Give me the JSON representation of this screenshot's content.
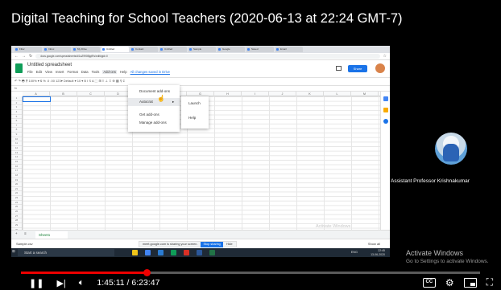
{
  "video": {
    "title": "Digital Teaching for School Teachers (2020-06-13 at 22:24 GMT-7)",
    "current_time": "1:45:11",
    "duration": "6:23:47",
    "progress": 0.274,
    "participant_name": "Assistant Professor Krishnakumar",
    "activate_title": "Activate Windows",
    "activate_sub": "Go to Settings to activate Windows."
  },
  "browser": {
    "url": "docs.google.com/spreadsheets/d/1aZ990BjqtRs/edit#gid=0",
    "tabs": [
      "Filter",
      "Inbox",
      "My Drive",
      "Untitled",
      "Contact",
      "Untitled",
      "Sample",
      "Google",
      "Saved",
      "Email"
    ]
  },
  "sheets": {
    "doc_title": "Untitled spreadsheet",
    "menus": [
      "File",
      "Edit",
      "View",
      "Insert",
      "Format",
      "Data",
      "Tools",
      "Add-ons",
      "Help"
    ],
    "saved_text": "All changes saved in Drive",
    "share_label": "Share",
    "toolbar_text": "↶ ↷ 🖶 ⁋  100% ▾  $  %  .0  .00  123▾  Default ▾  10 ▾  B  I  S  A  ⬚  ⊞  ≡  ⊥  ⇳  ⊕  ▦  ⚲  Σ",
    "columns": [
      "A",
      "B",
      "C",
      "D",
      "E",
      "F",
      "G",
      "H",
      "I",
      "J",
      "K",
      "L",
      "M"
    ],
    "rows": [
      "1",
      "2",
      "3",
      "4",
      "5",
      "6",
      "7",
      "8",
      "9",
      "10",
      "11",
      "12",
      "13",
      "14",
      "15",
      "16",
      "17",
      "18",
      "19",
      "20",
      "21",
      "22",
      "23",
      "24",
      "25",
      "26",
      "27",
      "28",
      "29",
      "30"
    ],
    "addons_menu": {
      "items": [
        "Document add-ons",
        "Autocrat",
        "Get add-ons",
        "Manage add-ons"
      ],
      "submenu": [
        "Launch",
        "Help"
      ]
    },
    "sheet_tab": "Sheet1"
  },
  "screen": {
    "windows_watermark": "Activate Windows",
    "download_item": "Sample.csv",
    "sharing_text": "meet.google.com is sharing your screen.",
    "stop_sharing": "Stop sharing",
    "hide": "Hide",
    "show_all": "Show all",
    "taskbar_search": "Start a search",
    "clock_time": "22:45",
    "clock_date": "13-06-2020",
    "tray_text": "ENG"
  }
}
